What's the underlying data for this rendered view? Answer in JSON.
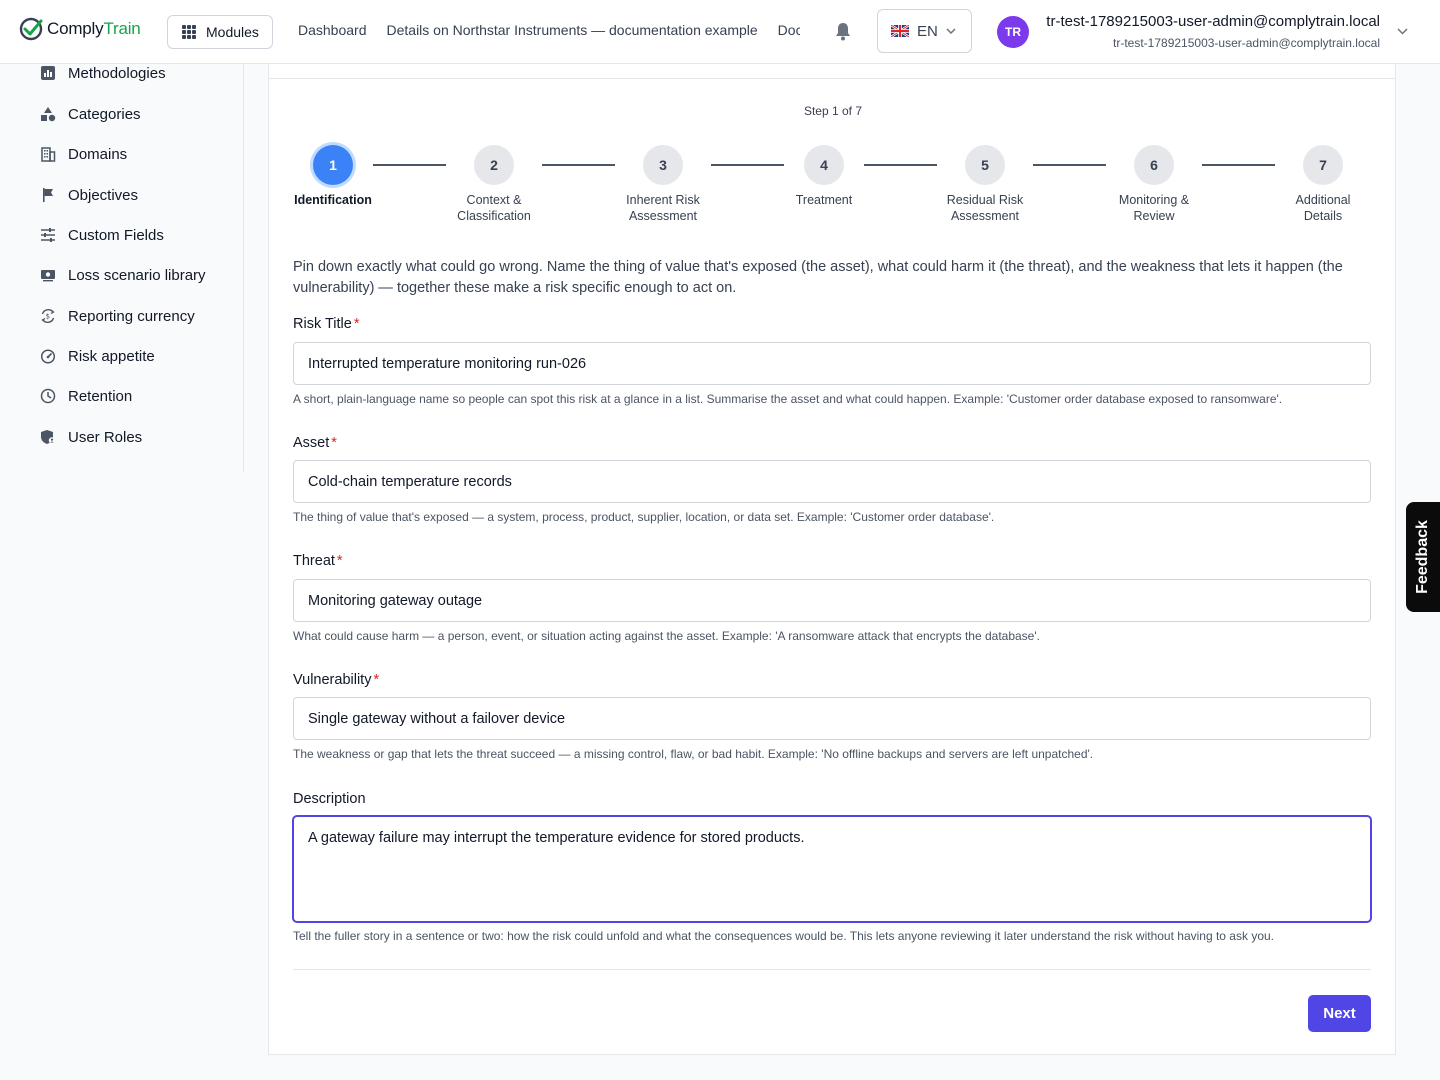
{
  "header": {
    "logo_prefix": "Comply",
    "logo_suffix": "Train",
    "modules_label": "Modules",
    "breadcrumbs": [
      "Dashboard",
      "Details on Northstar Instruments — documentation example",
      "Documents"
    ],
    "language": "EN",
    "avatar_initials": "TR",
    "user_name": "tr-test-1789215003-user-admin@complytrain.local",
    "user_email": "tr-test-1789215003-user-admin@complytrain.local"
  },
  "sidebar": {
    "items": [
      {
        "label": "Methodologies",
        "icon": "chart-icon"
      },
      {
        "label": "Categories",
        "icon": "shapes-icon"
      },
      {
        "label": "Domains",
        "icon": "building-icon"
      },
      {
        "label": "Objectives",
        "icon": "flag-icon"
      },
      {
        "label": "Custom Fields",
        "icon": "sliders-icon"
      },
      {
        "label": "Loss scenario library",
        "icon": "money-icon"
      },
      {
        "label": "Reporting currency",
        "icon": "currency-exchange-icon"
      },
      {
        "label": "Risk appetite",
        "icon": "gauge-icon"
      },
      {
        "label": "Retention",
        "icon": "clock-icon"
      },
      {
        "label": "User Roles",
        "icon": "shield-user-icon"
      }
    ]
  },
  "wizard": {
    "step_indicator": "Step 1 of 7",
    "steps": [
      {
        "number": "1",
        "label": "Identification"
      },
      {
        "number": "2",
        "label": "Context & Classification"
      },
      {
        "number": "3",
        "label": "Inherent Risk Assessment"
      },
      {
        "number": "4",
        "label": "Treatment"
      },
      {
        "number": "5",
        "label": "Residual Risk Assessment"
      },
      {
        "number": "6",
        "label": "Monitoring & Review"
      },
      {
        "number": "7",
        "label": "Additional Details"
      }
    ],
    "intro": "Pin down exactly what could go wrong. Name the thing of value that's exposed (the asset), what could harm it (the threat), and the weakness that lets it happen (the vulnerability) — together these make a risk specific enough to act on.",
    "fields": {
      "title": {
        "label": "Risk Title",
        "value": "Interrupted temperature monitoring run-026",
        "help": "A short, plain-language name so people can spot this risk at a glance in a list. Summarise the asset and what could happen. Example: 'Customer order database exposed to ransomware'."
      },
      "asset": {
        "label": "Asset",
        "value": "Cold-chain temperature records",
        "help": "The thing of value that's exposed — a system, process, product, supplier, location, or data set. Example: 'Customer order database'."
      },
      "threat": {
        "label": "Threat",
        "value": "Monitoring gateway outage",
        "help": "What could cause harm — a person, event, or situation acting against the asset. Example: 'A ransomware attack that encrypts the database'."
      },
      "vulnerability": {
        "label": "Vulnerability",
        "value": "Single gateway without a failover device",
        "help": "The weakness or gap that lets the threat succeed — a missing control, flaw, or bad habit. Example: 'No offline backups and servers are left unpatched'."
      },
      "description": {
        "label": "Description",
        "value": "A gateway failure may interrupt the temperature evidence for stored products.",
        "help": "Tell the fuller story in a sentence or two: how the risk could unfold and what the consequences would be. This lets anyone reviewing it later understand the risk without having to ask you."
      }
    },
    "required_marker": "*",
    "next_label": "Next"
  },
  "feedback_label": "Feedback",
  "colors": {
    "primary": "#4f46e5",
    "active_step": "#3b82f6",
    "brand_green": "#16a34a",
    "avatar": "#7c3aed"
  }
}
